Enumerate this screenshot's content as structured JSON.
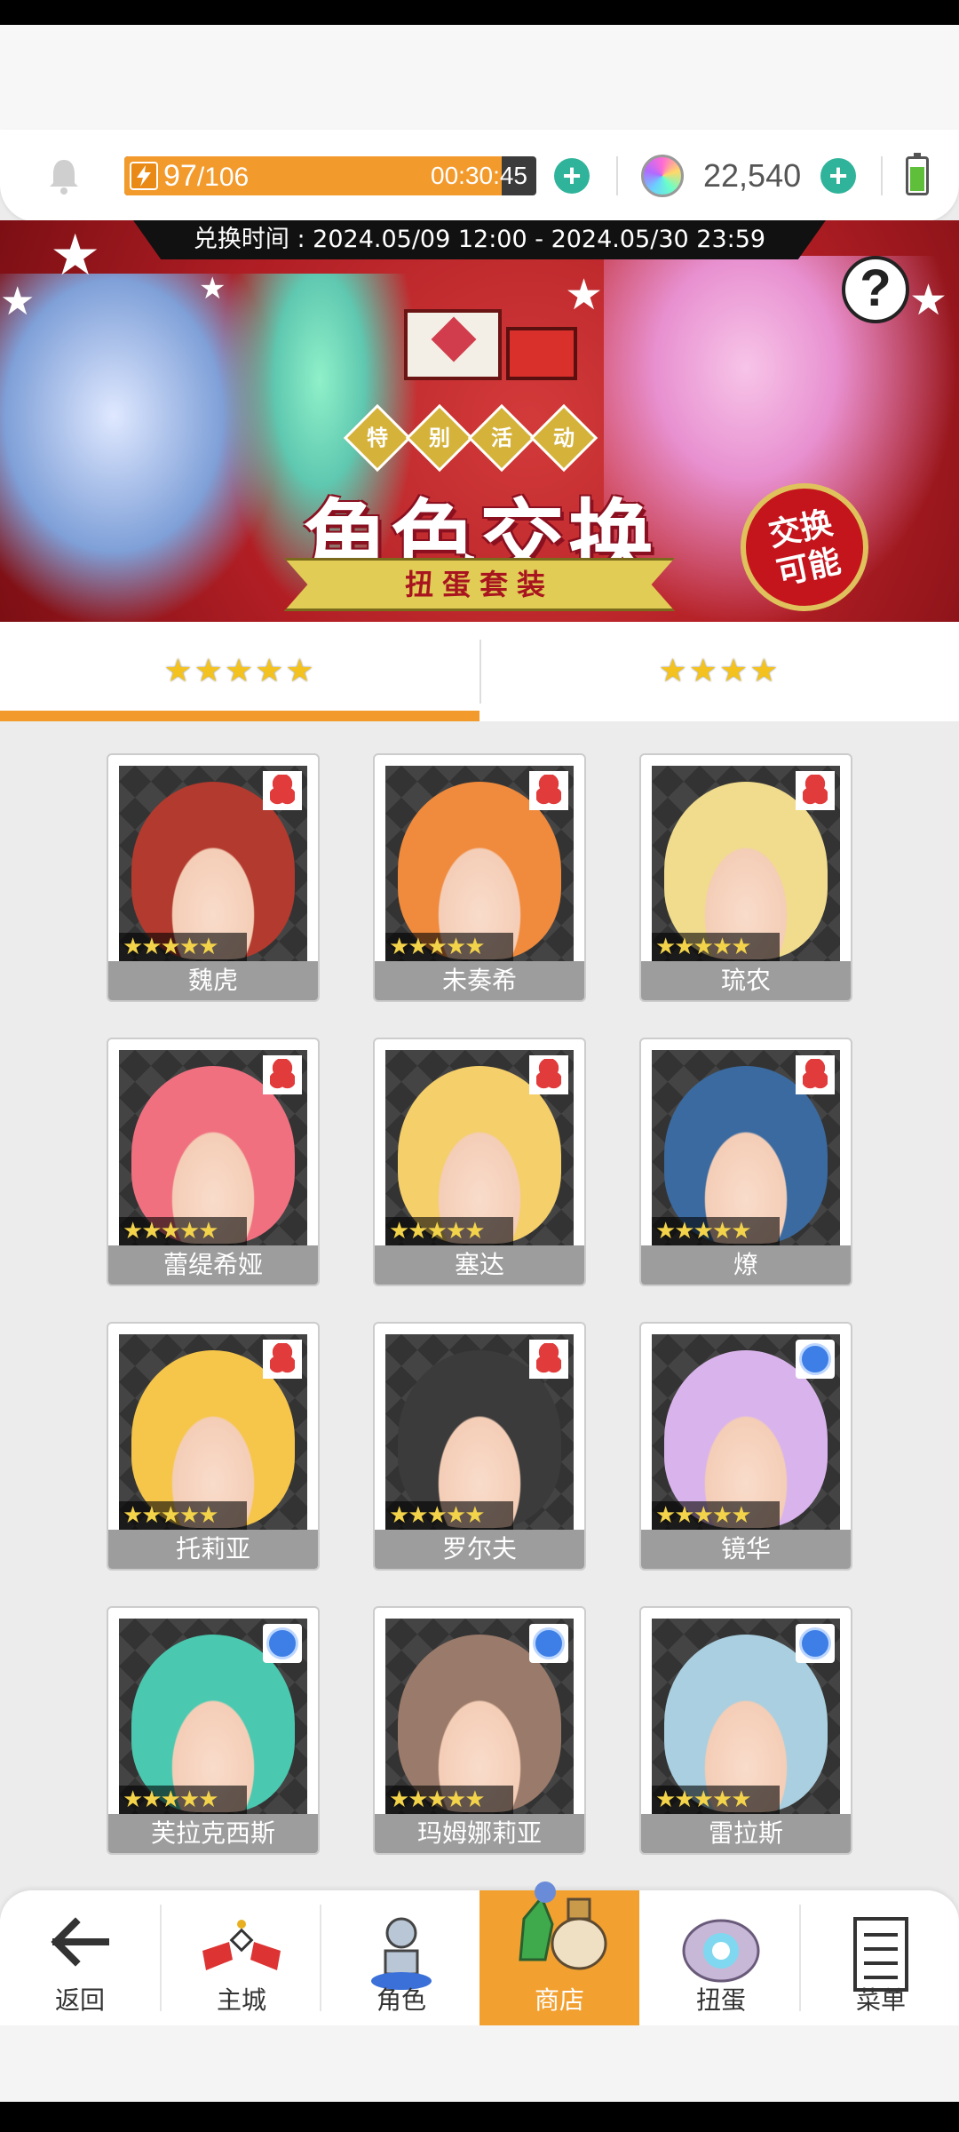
{
  "resources": {
    "stamina_current": "97",
    "stamina_max": "/106",
    "stamina_fraction": 0.915,
    "stamina_timer": "00:30:45",
    "gems": "22,540"
  },
  "banner": {
    "exchange_period": "兑换时间 : 2024.05/09 12:00 - 2024.05/30 23:59",
    "event_chars": [
      "特",
      "别",
      "活",
      "动"
    ],
    "main_title": "角色交换",
    "subtitle": "扭蛋套装",
    "swap_badge": "交换\n可能",
    "help": "?"
  },
  "tabs": [
    {
      "label": "★★★★★",
      "active": true
    },
    {
      "label": "★★★★",
      "active": false
    }
  ],
  "characters": [
    {
      "name": "魏虎",
      "stars": "★★★★★",
      "rank": "diamond",
      "color": "#b23a2e"
    },
    {
      "name": "未奏希",
      "stars": "★★★★★",
      "rank": "diamond",
      "color": "#f08a3c"
    },
    {
      "name": "琉农",
      "stars": "★★★★★",
      "rank": "diamond",
      "color": "#f0dc8c"
    },
    {
      "name": "蕾缇希娅",
      "stars": "★★★★★",
      "rank": "diamond",
      "color": "#f07080"
    },
    {
      "name": "塞达",
      "stars": "★★★★★",
      "rank": "diamond",
      "color": "#f4cf6a"
    },
    {
      "name": "燎",
      "stars": "★★★★★",
      "rank": "diamond",
      "color": "#3a6aa0"
    },
    {
      "name": "托莉亚",
      "stars": "★★★★★",
      "rank": "diamond",
      "color": "#f6c64a"
    },
    {
      "name": "罗尔夫",
      "stars": "★★★★★",
      "rank": "diamond",
      "color": "#3b3b3b"
    },
    {
      "name": "镜华",
      "stars": "★★★★★",
      "rank": "circle",
      "color": "#d9b4ec"
    },
    {
      "name": "芙拉克西斯",
      "stars": "★★★★★",
      "rank": "circle",
      "color": "#4ac9b0"
    },
    {
      "name": "玛姆娜莉亚",
      "stars": "★★★★★",
      "rank": "circle",
      "color": "#9a7a6a"
    },
    {
      "name": "雷拉斯",
      "stars": "★★★★★",
      "rank": "circle",
      "color": "#a9cfe0"
    }
  ],
  "nav": [
    {
      "label": "返回",
      "icon": "back-arrow-icon"
    },
    {
      "label": "主城",
      "icon": "castle-icon"
    },
    {
      "label": "角色",
      "icon": "character-icon"
    },
    {
      "label": "商店",
      "icon": "shop-icon",
      "active": true
    },
    {
      "label": "扭蛋",
      "icon": "gacha-icon"
    },
    {
      "label": "菜单",
      "icon": "menu-icon"
    }
  ],
  "colors": {
    "accent_orange": "#f29a2c",
    "plus_green": "#2fb39a",
    "banner_red": "#b01e24",
    "name_bar": "#9d9d9d"
  }
}
